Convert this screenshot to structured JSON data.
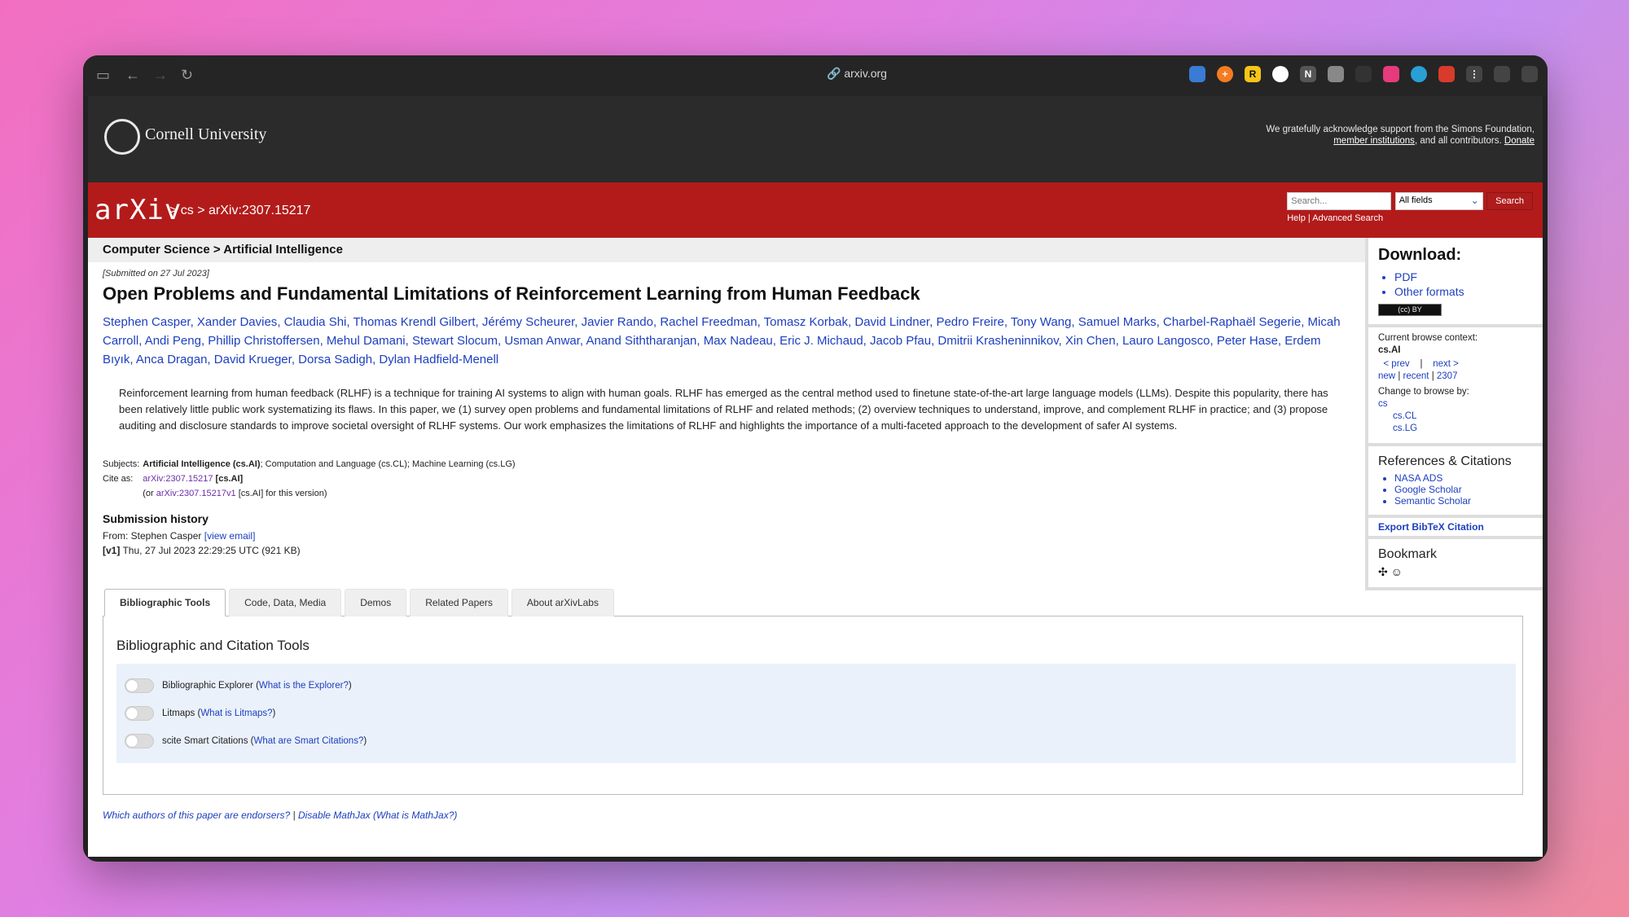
{
  "browser": {
    "url": "arxiv.org"
  },
  "cornell": {
    "name": "Cornell University",
    "ack_line1": "We gratefully acknowledge support from the Simons Foundation,",
    "ack_link": "member institutions",
    "ack_mid": ", and all contributors.",
    "ack_donate": "Donate"
  },
  "arxiv": {
    "logo": "arXiv",
    "breadcrumb": "> cs > arXiv:2307.15217",
    "search_placeholder": "Search...",
    "field_select": "All fields",
    "search_button": "Search",
    "help": "Help",
    "sep": "|",
    "advanced": "Advanced Search"
  },
  "paper": {
    "subject_header": "Computer Science > Artificial Intelligence",
    "submitted": "[Submitted on 27 Jul 2023]",
    "title": "Open Problems and Fundamental Limitations of Reinforcement Learning from Human Feedback",
    "authors": [
      "Stephen Casper",
      "Xander Davies",
      "Claudia Shi",
      "Thomas Krendl Gilbert",
      "Jérémy Scheurer",
      "Javier Rando",
      "Rachel Freedman",
      "Tomasz Korbak",
      "David Lindner",
      "Pedro Freire",
      "Tony Wang",
      "Samuel Marks",
      "Charbel-Raphaël Segerie",
      "Micah Carroll",
      "Andi Peng",
      "Phillip Christoffersen",
      "Mehul Damani",
      "Stewart Slocum",
      "Usman Anwar",
      "Anand Siththaranjan",
      "Max Nadeau",
      "Eric J. Michaud",
      "Jacob Pfau",
      "Dmitrii Krasheninnikov",
      "Xin Chen",
      "Lauro Langosco",
      "Peter Hase",
      "Erdem Bıyık",
      "Anca Dragan",
      "David Krueger",
      "Dorsa Sadigh",
      "Dylan Hadfield-Menell"
    ],
    "abstract": "Reinforcement learning from human feedback (RLHF) is a technique for training AI systems to align with human goals. RLHF has emerged as the central method used to finetune state-of-the-art large language models (LLMs). Despite this popularity, there has been relatively little public work systematizing its flaws. In this paper, we (1) survey open problems and fundamental limitations of RLHF and related methods; (2) overview techniques to understand, improve, and complement RLHF in practice; and (3) propose auditing and disclosure standards to improve societal oversight of RLHF systems. Our work emphasizes the limitations of RLHF and highlights the importance of a multi-faceted approach to the development of safer AI systems.",
    "subjects_label": "Subjects:",
    "subjects_primary": "Artificial Intelligence (cs.AI)",
    "subjects_rest": "; Computation and Language (cs.CL); Machine Learning (cs.LG)",
    "cite_label": "Cite as:",
    "cite_id": "arXiv:2307.15217",
    "cite_tag": "[cs.AI]",
    "cite_or": "(or",
    "cite_version": "arXiv:2307.15217v1",
    "cite_version_tail": "[cs.AI] for this version)",
    "history_title": "Submission history",
    "history_from": "From: Stephen Casper",
    "history_view_email": "[view email]",
    "history_v1_tag": "[v1]",
    "history_v1": "Thu, 27 Jul 2023 22:29:25 UTC (921 KB)"
  },
  "tabs": [
    {
      "label": "Bibliographic Tools",
      "active": true
    },
    {
      "label": "Code, Data, Media"
    },
    {
      "label": "Demos"
    },
    {
      "label": "Related Papers"
    },
    {
      "label": "About arXivLabs"
    }
  ],
  "panel": {
    "title": "Bibliographic and Citation Tools",
    "tools": [
      {
        "label": "Bibliographic Explorer",
        "link": "What is the Explorer?"
      },
      {
        "label": "Litmaps",
        "link": "What is Litmaps?"
      },
      {
        "label": "scite Smart Citations",
        "link": "What are Smart Citations?"
      }
    ]
  },
  "footer": {
    "endorsers": "Which authors of this paper are endorsers?",
    "sep": "|",
    "disable_mathjax": "Disable MathJax",
    "what_mathjax": "(What is MathJax?)"
  },
  "sidebar": {
    "download_title": "Download:",
    "pdf": "PDF",
    "other_formats": "Other formats",
    "cc_badge": "(cc) BY",
    "browse_context_label": "Current browse context:",
    "browse_context": "cs.AI",
    "prev": "< prev",
    "bar": "|",
    "next": "next >",
    "new": "new",
    "recent": "recent",
    "year": "2307",
    "change_label": "Change to browse by:",
    "cs": "cs",
    "cs_cl": "cs.CL",
    "cs_lg": "cs.LG",
    "refs_title": "References & Citations",
    "nasa": "NASA ADS",
    "google": "Google Scholar",
    "semantic": "Semantic Scholar",
    "bibtex": "Export BibTeX Citation",
    "bookmark": "Bookmark"
  }
}
